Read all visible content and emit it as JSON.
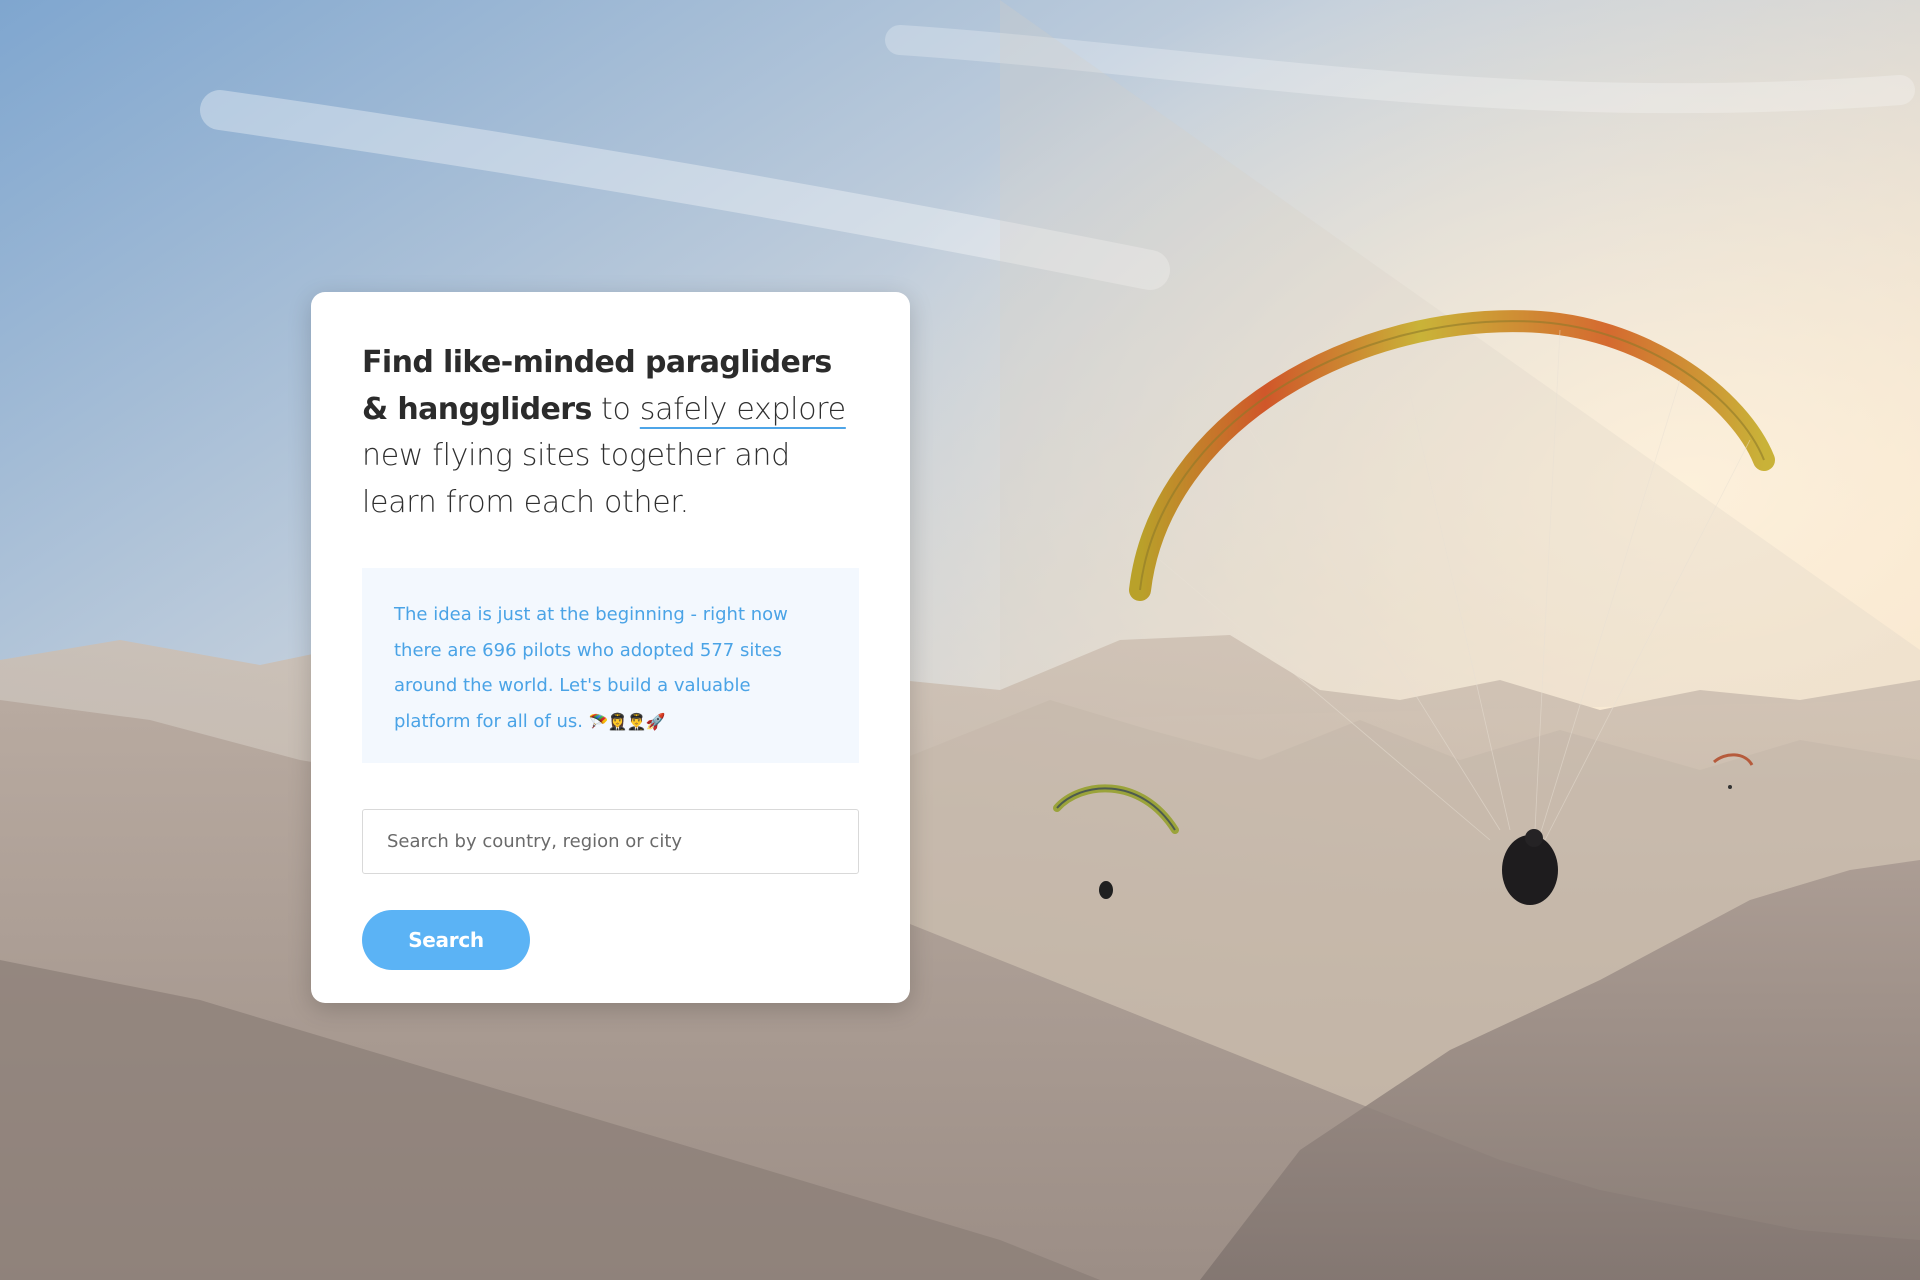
{
  "hero": {
    "headline_bold": "Find like-minded paragliders & hanggliders",
    "headline_to": "to",
    "headline_highlight": "safely explore",
    "headline_rest": "new flying sites together and learn from each other."
  },
  "info": {
    "text": "The idea is just at the beginning - right now there are 696 pilots who adopted 577 sites around the world. Let's build a valuable platform for all of us.",
    "emoji": "🪂👩‍✈️👨‍✈️🚀"
  },
  "search": {
    "placeholder": "Search by country, region or city",
    "button_label": "Search"
  },
  "colors": {
    "accent": "#5bb3f5",
    "info_text": "#4aa3e6",
    "info_bg": "#f3f8fe"
  }
}
